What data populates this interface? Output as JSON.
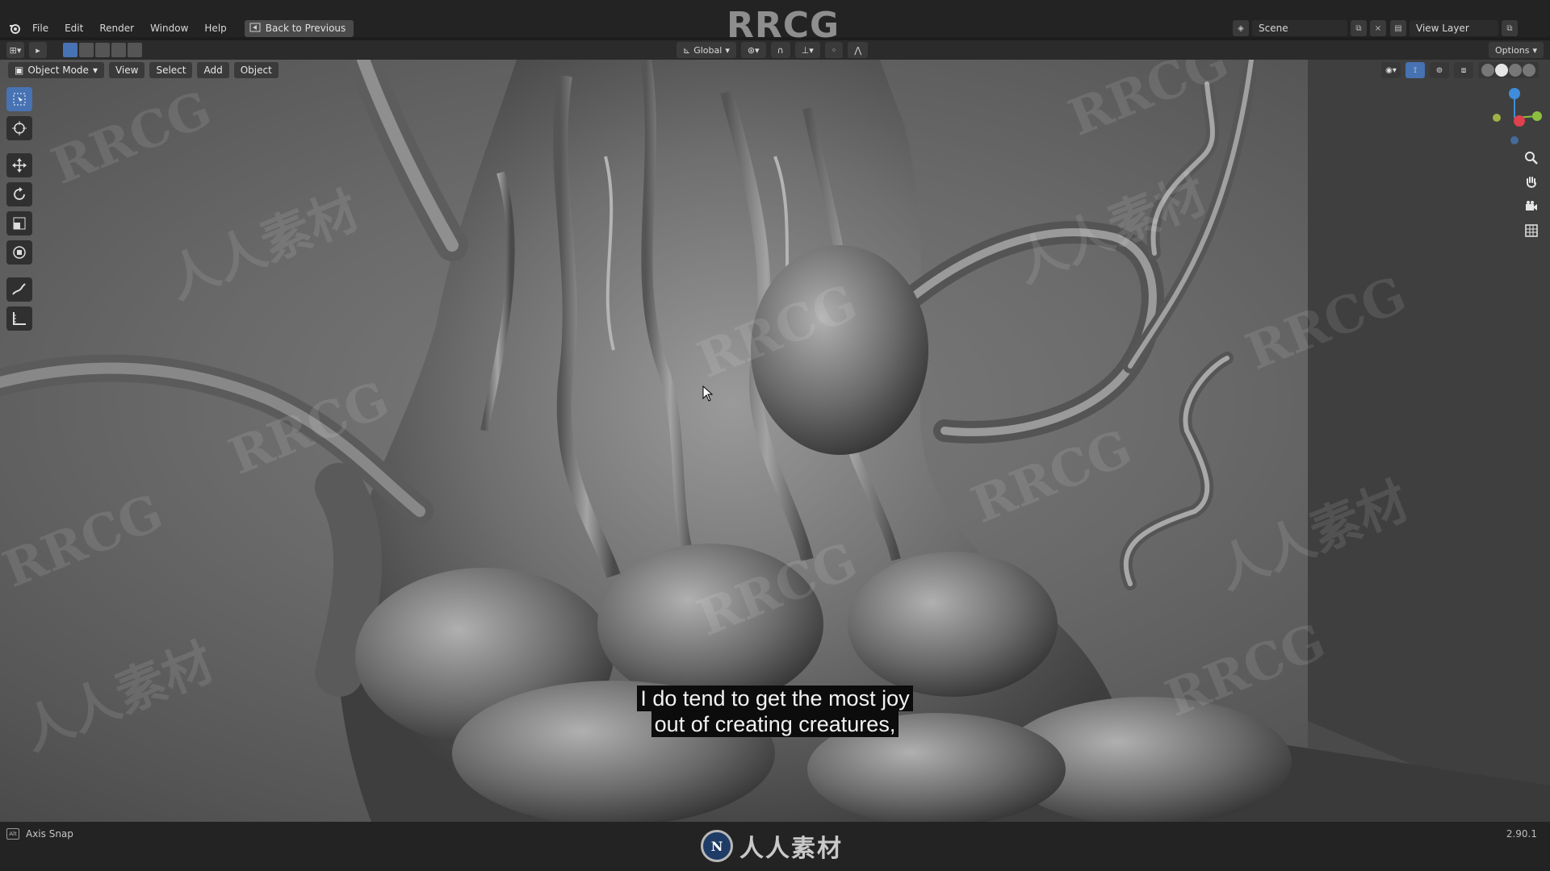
{
  "menubar": {
    "items": [
      "File",
      "Edit",
      "Render",
      "Window",
      "Help"
    ],
    "back_label": "Back to Previous",
    "scene_label": "Scene",
    "view_layer_label": "View Layer"
  },
  "header_tools": {
    "orientation_label": "Global",
    "options_label": "Options"
  },
  "viewport_header": {
    "mode_label": "Object Mode",
    "view_label": "View",
    "select_label": "Select",
    "add_label": "Add",
    "object_label": "Object"
  },
  "subtitle": {
    "line1": "I do tend to get the most joy",
    "line2": "out of creating creatures,"
  },
  "statusbar": {
    "hint_key": "Alt",
    "hint_label": "Axis Snap",
    "version": "2.90.1"
  },
  "watermark": {
    "top_text": "RRCG",
    "repeat_text": "RRCG",
    "repeat_text_cn": "人人素材",
    "brand_logo": "N",
    "brand_text": "人人素材"
  },
  "colors": {
    "accent": "#4772b3",
    "axis_x": "#e0414f",
    "axis_y": "#8cbf3f",
    "axis_z": "#3f8cdb"
  },
  "icons": {
    "logo": "blender-logo-icon",
    "back": "back-icon",
    "tools": [
      "select-box-icon",
      "cursor-icon",
      "move-icon",
      "rotate-icon",
      "scale-icon",
      "transform-icon",
      "annotate-icon",
      "measure-icon"
    ],
    "nav": [
      "zoom-icon",
      "pan-hand-icon",
      "camera-icon",
      "ortho-grid-icon"
    ]
  }
}
